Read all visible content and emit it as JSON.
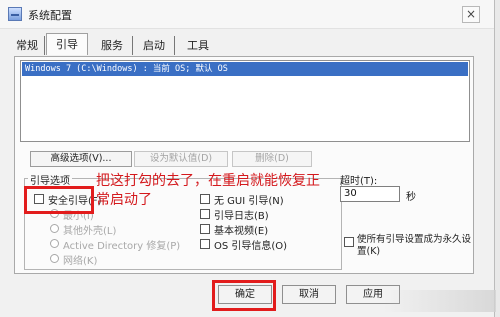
{
  "window": {
    "title": "系统配置",
    "close_glyph": "×"
  },
  "tabs": [
    {
      "label": "常规",
      "active": false
    },
    {
      "label": "引导",
      "active": true
    },
    {
      "label": "服务",
      "active": false
    },
    {
      "label": "启动",
      "active": false
    },
    {
      "label": "工具",
      "active": false
    }
  ],
  "os_list": {
    "selected_entry": "Windows 7 (C:\\Windows) : 当前 OS; 默认 OS"
  },
  "buttons": {
    "advanced": "高级选项(V)...",
    "set_default": "设为默认值(D)",
    "delete": "删除(D)"
  },
  "boot_options": {
    "title": "引导选项",
    "safe_boot": "安全引导(F)",
    "radio_minimal": "最小(I)",
    "radio_alternate_shell": "其他外壳(L)",
    "radio_ad_repair": "Active Directory 修复(P)",
    "radio_network": "网络(K)",
    "no_gui": "无 GUI 引导(N)",
    "boot_log": "引导日志(B)",
    "base_video": "基本视频(E)",
    "os_boot_info": "OS 引导信息(O)"
  },
  "timeout": {
    "label": "超时(T):",
    "value": "30",
    "unit": "秒"
  },
  "permanent": {
    "label": "使所有引导设置成为永久设置(K)"
  },
  "annotation": {
    "text": "把这打勾的去了，在重启就能恢复正常启动了"
  },
  "footer": {
    "ok": "确定",
    "cancel": "取消",
    "apply": "应用"
  },
  "colors": {
    "annotation": "#d4191d",
    "highlight": "#e21c1c",
    "selection": "#3a6fc4"
  }
}
